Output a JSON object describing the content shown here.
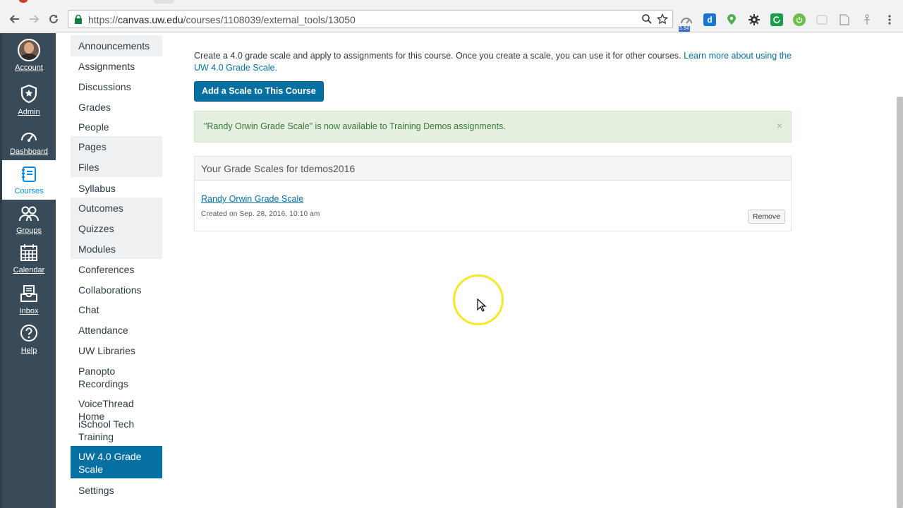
{
  "browser": {
    "url_scheme": "https://",
    "url_host": "canvas.uw.edu",
    "url_path": "/courses/1108039/external_tools/13050",
    "ext_badge": "5.94",
    "ext_d_letter": "d"
  },
  "global_nav": {
    "items": [
      {
        "label": "Account",
        "icon": "avatar"
      },
      {
        "label": "Admin",
        "icon": "shield-star-icon"
      },
      {
        "label": "Dashboard",
        "icon": "dashboard-icon"
      },
      {
        "label": "Courses",
        "icon": "courses-icon",
        "active": true
      },
      {
        "label": "Groups",
        "icon": "groups-icon"
      },
      {
        "label": "Calendar",
        "icon": "calendar-icon"
      },
      {
        "label": "Inbox",
        "icon": "inbox-icon"
      },
      {
        "label": "Help",
        "icon": "help-icon"
      }
    ]
  },
  "course_nav": {
    "items": [
      {
        "label": "Announcements",
        "hidden": true
      },
      {
        "label": "Assignments"
      },
      {
        "label": "Discussions"
      },
      {
        "label": "Grades"
      },
      {
        "label": "People"
      },
      {
        "label": "Pages",
        "hidden": true
      },
      {
        "label": "Files",
        "hidden": true
      },
      {
        "label": "Syllabus"
      },
      {
        "label": "Outcomes",
        "hidden": true
      },
      {
        "label": "Quizzes",
        "hidden": true
      },
      {
        "label": "Modules",
        "hidden": true
      },
      {
        "label": "Conferences"
      },
      {
        "label": "Collaborations"
      },
      {
        "label": "Chat"
      },
      {
        "label": "Attendance"
      },
      {
        "label": "UW Libraries"
      },
      {
        "label": "Panopto Recordings"
      },
      {
        "label": "VoiceThread Home"
      },
      {
        "label": "iSchool Tech Training"
      },
      {
        "label": "UW 4.0 Grade Scale",
        "selected": true
      },
      {
        "label": "Settings"
      }
    ]
  },
  "main": {
    "intro_text": "Create a 4.0 grade scale and apply to assignments for this course. Once you create a scale, you can use it for other courses.",
    "intro_link": "Learn more about using the UW 4.0 Grade Scale.",
    "add_button": "Add a Scale to This Course",
    "alert_message": "\"Randy Orwin Grade Scale\" is now available to Training Demos assignments.",
    "alert_close": "×",
    "panel_title": "Your Grade Scales for tdemos2016",
    "scale_name": "Randy Orwin Grade Scale",
    "scale_created": "Created on Sep. 28, 2016, 10:10 am",
    "remove_button": "Remove"
  },
  "colors": {
    "global_nav_bg": "#394b58",
    "accent": "#0770a3",
    "alert_bg": "#e3efdf",
    "alert_text": "#3c763d"
  }
}
